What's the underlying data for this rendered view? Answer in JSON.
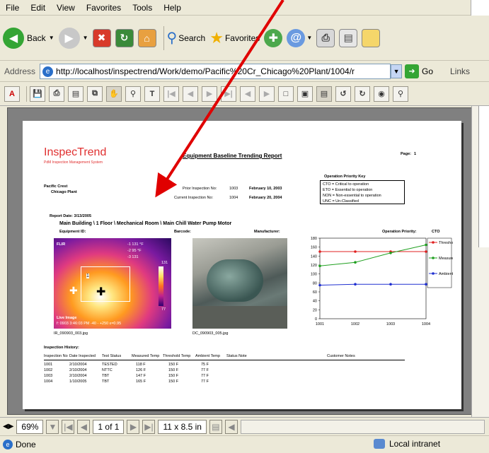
{
  "menu": {
    "file": "File",
    "edit": "Edit",
    "view": "View",
    "favorites": "Favorites",
    "tools": "Tools",
    "help": "Help"
  },
  "toolbar": {
    "back": "Back",
    "search": "Search",
    "favorites": "Favorites"
  },
  "address": {
    "label": "Address",
    "url": "http://localhost/inspectrend/Work/demo/Pacific%20Cr_Chicago%20Plant/1004/r",
    "go": "Go",
    "links": "Links"
  },
  "pdfnav": {
    "zoom": "69%",
    "page": "1 of 1",
    "size": "11 x 8.5 in"
  },
  "status": {
    "done": "Done",
    "zone": "Local intranet"
  },
  "report": {
    "brand": "InspecTrend",
    "tagline": "PdM Inspection Management System",
    "title": "Equipment Baseline Trending Report",
    "page_label": "Page:",
    "page_no": "1",
    "client": "Pacific Crest",
    "plant": "Chicago Plant",
    "prior_label": "Prior Inspection No:",
    "prior_no": "1003",
    "prior_date": "February 10, 2003",
    "current_label": "Current Inspection No:",
    "current_no": "1004",
    "current_date": "February 20, 2004",
    "key_title": "Operation Priority Key",
    "key_lines": [
      "CTO = Critical to operation",
      "ETO = Essential to operation",
      "NON = Non-essential to operation",
      "UNC = Un-Classified"
    ],
    "report_date": "Report Date:  3/13/2005",
    "location": "Main Building \\ 1 Floor \\ Mechanical Room \\ Main Chill Water Pump Motor",
    "equip_label": "Equipment ID:",
    "barcode_label": "Barcode:",
    "manufacturer_label": "Manufacturer:",
    "priority_label": "Operation Priority:",
    "priority_value": "CTO",
    "ir_caption": "IR_090903_003.jpg",
    "dc_caption": "DC_090903_005.jpg",
    "history_title": "Inspection History:",
    "history_headers": [
      "Inspection No",
      "Date Inspected",
      "Test Status",
      "Measured Temp",
      "Threshold Temp",
      "Ambient Temp",
      "Status Note",
      "Customer Notes"
    ],
    "history_rows": [
      [
        "1001",
        "2/10/2004",
        "TESTED",
        "118  F",
        "150  F",
        "75  F"
      ],
      [
        "1002",
        "2/10/2004",
        "NTTC",
        "126  F",
        "150  F",
        "77  F"
      ],
      [
        "1003",
        "2/10/2004",
        "TBT",
        "147  F",
        "150  F",
        "77  F"
      ],
      [
        "1004",
        "1/10/2005",
        "TBT",
        "165  F",
        "150  F",
        "77  F"
      ]
    ],
    "ir_text": {
      "brand": "FLIR",
      "t1": "-1  131 °F",
      "t2": "-2  95 °F",
      "t3": "-3  131",
      "t4": "131",
      "t5": "77",
      "live": "Live Image",
      "footer": "f: 0903  3:46:03 PM  -40 - +250  ε=0.95"
    }
  },
  "chart_data": {
    "type": "line",
    "x": [
      "1001",
      "1002",
      "1003",
      "1004"
    ],
    "ylim": [
      0,
      180
    ],
    "yticks": [
      0,
      20,
      40,
      60,
      80,
      100,
      120,
      140,
      160,
      180
    ],
    "series": [
      {
        "name": "Threshold",
        "values": [
          150,
          150,
          150,
          150
        ],
        "color": "#e02020"
      },
      {
        "name": "Measured",
        "values": [
          118,
          126,
          147,
          165
        ],
        "color": "#20a020"
      },
      {
        "name": "Ambient",
        "values": [
          75,
          77,
          77,
          77
        ],
        "color": "#2030d0"
      }
    ],
    "legend": "right"
  }
}
